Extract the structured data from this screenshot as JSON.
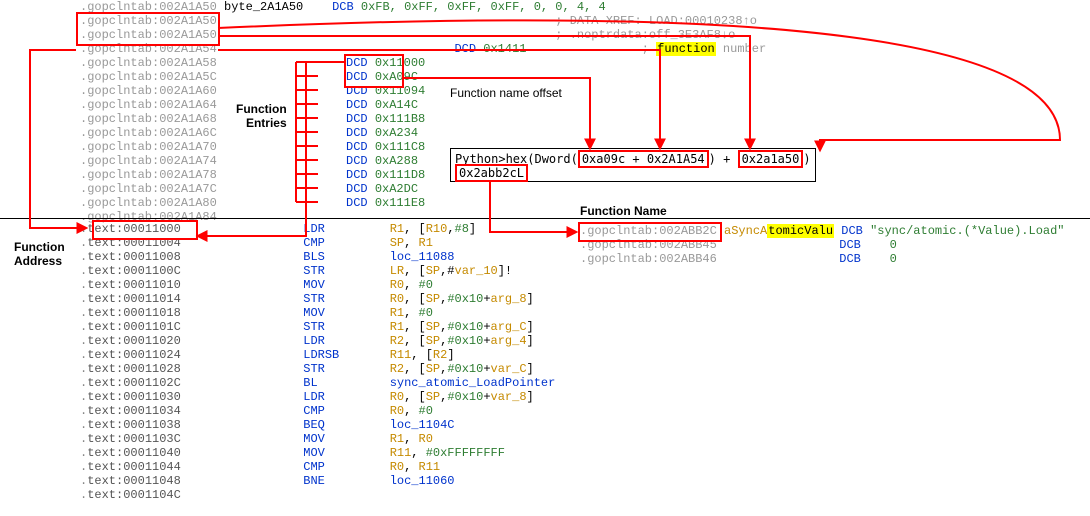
{
  "labels": {
    "function_entries_l1": "Function",
    "function_entries_l2": "Entries",
    "function_address_l1": "Function",
    "function_address_l2": "Address",
    "func_name_offset": "Function name offset",
    "func_name": "Function Name"
  },
  "header": {
    "line0_addr": ".gopclntab:002A1A50",
    "line0_label": "byte_2A1A50",
    "line0_op": "DCB",
    "line0_args": "0xFB, 0xFF, 0xFF, 0xFF, 0, 0, 4, 4",
    "line1_addr": ".gopclntab:002A1A50",
    "line1_cmt": "; DATA XREF: LOAD:00010238↑o",
    "line2_addr": ".gopclntab:002A1A50",
    "line2_cmt_a": "; .noptrdata:off_3E3AF8↓o",
    "line3_addr": ".gopclntab:002A1A54",
    "line3_op": "DCD",
    "line3_arg": "0x1411",
    "line3_cmt_pre": "; ",
    "line3_cmt_hl": "function",
    "line3_cmt_post": " number"
  },
  "entries": [
    {
      "addr": ".gopclntab:002A1A58",
      "op": "DCD",
      "arg": "0x11000"
    },
    {
      "addr": ".gopclntab:002A1A5C",
      "op": "DCD",
      "arg": "0xA09C"
    },
    {
      "addr": ".gopclntab:002A1A60",
      "op": "DCD",
      "arg": "0x11094"
    },
    {
      "addr": ".gopclntab:002A1A64",
      "op": "DCD",
      "arg": "0xA14C"
    },
    {
      "addr": ".gopclntab:002A1A68",
      "op": "DCD",
      "arg": "0x111B8"
    },
    {
      "addr": ".gopclntab:002A1A6C",
      "op": "DCD",
      "arg": "0xA234"
    },
    {
      "addr": ".gopclntab:002A1A70",
      "op": "DCD",
      "arg": "0x111C8"
    },
    {
      "addr": ".gopclntab:002A1A74",
      "op": "DCD",
      "arg": "0xA288"
    },
    {
      "addr": ".gopclntab:002A1A78",
      "op": "DCD",
      "arg": "0x111D8"
    },
    {
      "addr": ".gopclntab:002A1A7C",
      "op": "DCD",
      "arg": "0xA2DC"
    },
    {
      "addr": ".gopclntab:002A1A80",
      "op": "DCD",
      "arg": "0x111E8"
    },
    {
      "addr": ".gopclntab:002A1A84",
      "op": "",
      "arg": ""
    }
  ],
  "python": {
    "line1_a": "Python>hex(Dword(",
    "line1_b": "0xa09c + 0x2A1A54",
    "line1_c": ") + ",
    "line1_d": "0x2a1a50",
    "line1_e": ")",
    "line2": "0x2abb2cL"
  },
  "disasm": [
    {
      "addr": ".text:00011000",
      "op": "LDR",
      "args": "R1, [R10,#8]"
    },
    {
      "addr": ".text:00011004",
      "op": "CMP",
      "args": "SP, R1"
    },
    {
      "addr": ".text:00011008",
      "op": "BLS",
      "args": "loc_11088"
    },
    {
      "addr": ".text:0001100C",
      "op": "STR",
      "args": "LR, [SP,#var_10]!"
    },
    {
      "addr": ".text:00011010",
      "op": "MOV",
      "args": "R0, #0"
    },
    {
      "addr": ".text:00011014",
      "op": "STR",
      "args": "R0, [SP,#0x10+arg_8]"
    },
    {
      "addr": ".text:00011018",
      "op": "MOV",
      "args": "R1, #0"
    },
    {
      "addr": ".text:0001101C",
      "op": "STR",
      "args": "R1, [SP,#0x10+arg_C]"
    },
    {
      "addr": ".text:00011020",
      "op": "LDR",
      "args": "R2, [SP,#0x10+arg_4]"
    },
    {
      "addr": ".text:00011024",
      "op": "LDRSB",
      "args": "R11, [R2]"
    },
    {
      "addr": ".text:00011028",
      "op": "STR",
      "args": "R2, [SP,#0x10+var_C]"
    },
    {
      "addr": ".text:0001102C",
      "op": "BL",
      "args": "sync_atomic_LoadPointer"
    },
    {
      "addr": ".text:00011030",
      "op": "LDR",
      "args": "R0, [SP,#0x10+var_8]"
    },
    {
      "addr": ".text:00011034",
      "op": "CMP",
      "args": "R0, #0"
    },
    {
      "addr": ".text:00011038",
      "op": "BEQ",
      "args": "loc_1104C"
    },
    {
      "addr": ".text:0001103C",
      "op": "MOV",
      "args": "R1, R0"
    },
    {
      "addr": ".text:00011040",
      "op": "MOV",
      "args": "R11, #0xFFFFFFFF"
    },
    {
      "addr": ".text:00011044",
      "op": "CMP",
      "args": "R0, R11"
    },
    {
      "addr": ".text:00011048",
      "op": "BNE",
      "args": "loc_11060"
    },
    {
      "addr": ".text:0001104C",
      "op": "",
      "args": ""
    }
  ],
  "result": {
    "line1_addr": ".gopclntab:002ABB2C",
    "line1_name_a": "aSyncA",
    "line1_name_b": "tomicValu",
    "line1_op": "DCB",
    "line1_str": "\"sync/atomic.(*Value).Load\"",
    "line2_addr": ".gopclntab:002ABB45",
    "line2_op": "DCB",
    "line2_arg": "0",
    "line3_addr": ".gopclntab:002ABB46",
    "line3_op": "DCB",
    "line3_arg": "0"
  }
}
